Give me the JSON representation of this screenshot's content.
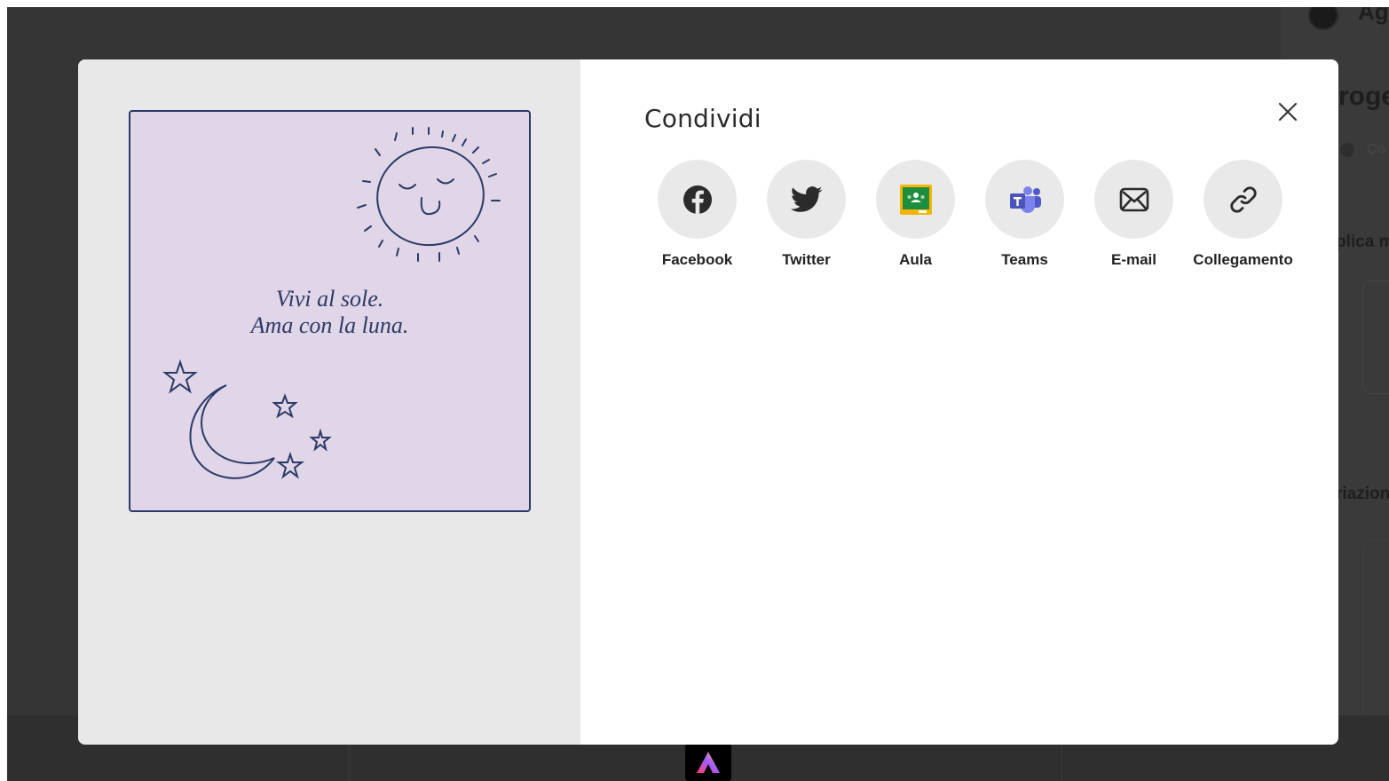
{
  "background": {
    "user_label": "Ag",
    "heading_partial": "roge",
    "toggle_label_partial": "Co",
    "text_partial_1": "plica m",
    "text_partial_2": "riazion"
  },
  "modal": {
    "title": "Condividi",
    "close_icon": "close-icon",
    "preview": {
      "quote_line1": "Vivi al sole.",
      "quote_line2": "Ama con la luna."
    },
    "share_options": [
      {
        "label": "Facebook",
        "icon": "facebook-icon"
      },
      {
        "label": "Twitter",
        "icon": "twitter-icon"
      },
      {
        "label": "Aula",
        "icon": "google-classroom-icon"
      },
      {
        "label": "Teams",
        "icon": "microsoft-teams-icon"
      },
      {
        "label": "E-mail",
        "icon": "email-icon"
      },
      {
        "label": "Collegamento",
        "icon": "link-icon"
      }
    ]
  },
  "colors": {
    "backdrop": "#353535",
    "preview_bg": "#e8e8e8",
    "artwork_bg": "#e1d5e8",
    "artwork_ink": "#2b3a68",
    "icon_circle": "#e9e9e9",
    "classroom_green": "#1e8e3e",
    "classroom_yellow": "#f5b400",
    "teams_purple": "#5b5fc7"
  }
}
